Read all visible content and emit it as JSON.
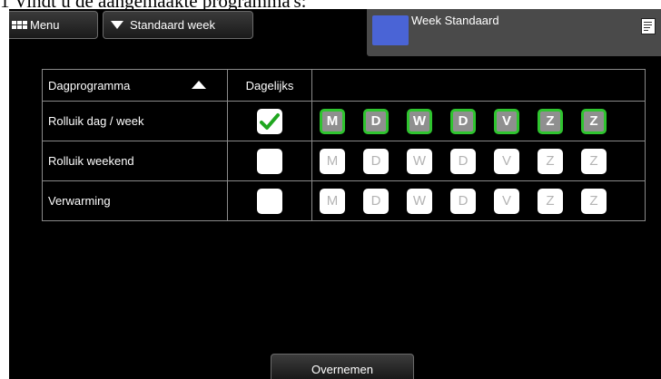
{
  "document": {
    "caption": "1 Vindt u de aangemaakte programma's:"
  },
  "toolbar": {
    "menu_label": "Menu",
    "week_label": "Standaard week"
  },
  "info_panel": {
    "title": "Week Standaard",
    "color": "#4a64d6"
  },
  "table": {
    "headers": {
      "program": "Dagprogramma",
      "daily": "Dagelijks"
    },
    "rows": [
      {
        "name": "Rolluik dag / week",
        "daily": true,
        "days": [
          {
            "letter": "M",
            "active": true
          },
          {
            "letter": "D",
            "active": true
          },
          {
            "letter": "W",
            "active": true
          },
          {
            "letter": "D",
            "active": true
          },
          {
            "letter": "V",
            "active": true
          },
          {
            "letter": "Z",
            "active": true
          },
          {
            "letter": "Z",
            "active": true
          }
        ]
      },
      {
        "name": "Rolluik weekend",
        "daily": false,
        "days": [
          {
            "letter": "M",
            "active": false
          },
          {
            "letter": "D",
            "active": false
          },
          {
            "letter": "W",
            "active": false
          },
          {
            "letter": "D",
            "active": false
          },
          {
            "letter": "V",
            "active": false
          },
          {
            "letter": "Z",
            "active": false
          },
          {
            "letter": "Z",
            "active": false
          }
        ]
      },
      {
        "name": "Verwarming",
        "daily": false,
        "days": [
          {
            "letter": "M",
            "active": false
          },
          {
            "letter": "D",
            "active": false
          },
          {
            "letter": "W",
            "active": false
          },
          {
            "letter": "D",
            "active": false
          },
          {
            "letter": "V",
            "active": false
          },
          {
            "letter": "Z",
            "active": false
          },
          {
            "letter": "Z",
            "active": false
          }
        ]
      }
    ]
  },
  "footer": {
    "apply_label": "Overnemen"
  },
  "colors": {
    "active_border": "#2fc42f",
    "active_fill": "#8f8f8f",
    "check": "#1fa61f"
  }
}
